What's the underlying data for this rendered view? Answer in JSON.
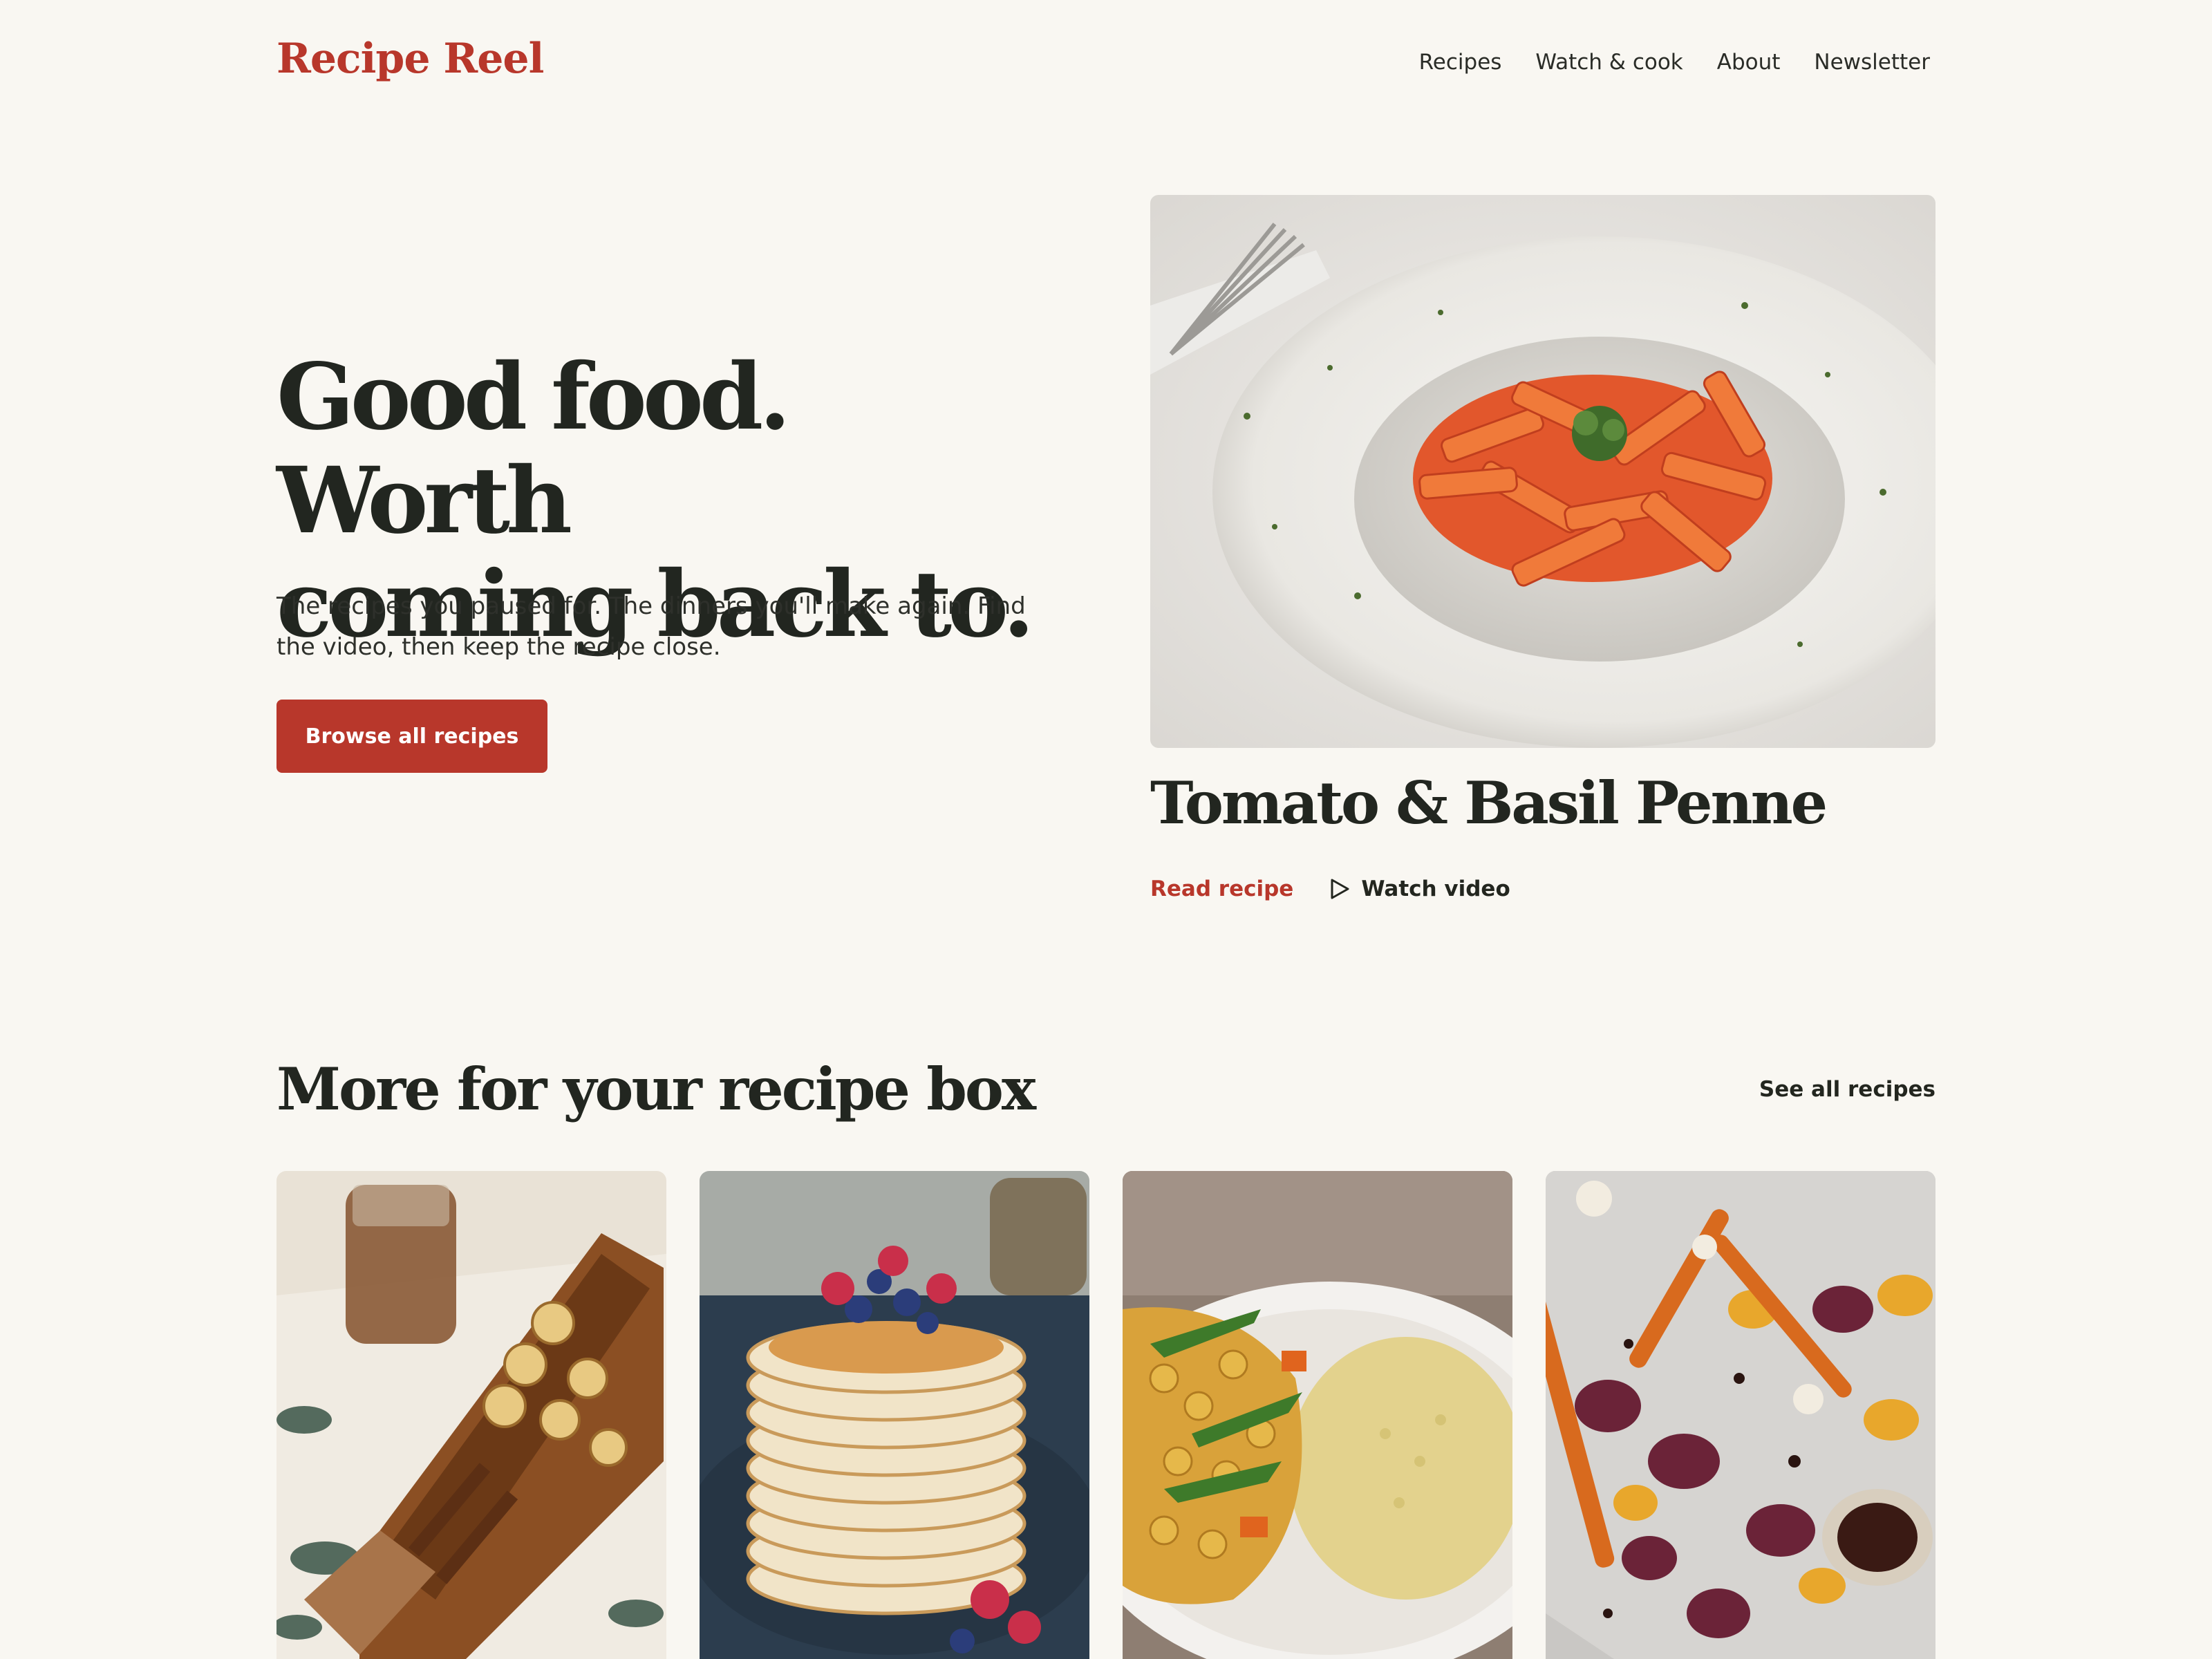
{
  "header": {
    "brand": "Recipe Reel",
    "nav": [
      "Recipes",
      "Watch & cook",
      "About",
      "Newsletter"
    ]
  },
  "hero": {
    "title_line1": "Good food. Worth",
    "title_line2": "coming back to.",
    "subtitle": "The recipes you paused for. The dinners you'll make again. Find the video, then keep the recipe close.",
    "cta_label": "Browse all recipes"
  },
  "featured": {
    "title": "Tomato & Basil Penne",
    "read_label": "Read recipe",
    "watch_label": "Watch video",
    "image_icon": "pasta-photo"
  },
  "section": {
    "title": "More for your recipe box",
    "see_all_label": "See all recipes",
    "cards": [
      {
        "image": "banana-bread-photo"
      },
      {
        "image": "pancakes-photo"
      },
      {
        "image": "chickpea-couscous-photo"
      },
      {
        "image": "roasted-vegetables-photo"
      }
    ]
  },
  "colors": {
    "accent": "#b8372b",
    "background": "#f9f7f2",
    "text": "#23261f"
  }
}
